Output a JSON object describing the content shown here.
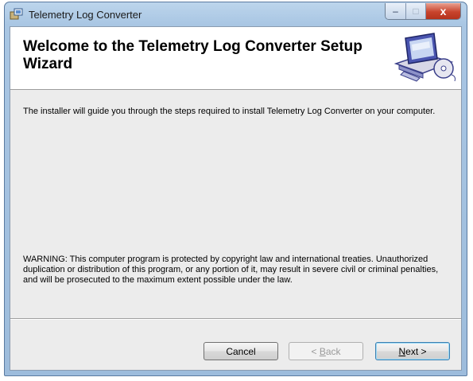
{
  "window": {
    "title": "Telemetry Log Converter",
    "controls": {
      "minimize": "–",
      "maximize": "□",
      "close": "x"
    }
  },
  "banner": {
    "heading": "Welcome to the Telemetry Log Converter Setup Wizard",
    "icon": "computer-setup-icon"
  },
  "body": {
    "intro": "The installer will guide you through the steps required to install Telemetry Log Converter on your computer.",
    "warning": "WARNING: This computer program is protected by copyright law and international treaties. Unauthorized duplication or distribution of this program, or any portion of it, may result in severe civil or criminal penalties, and will be prosecuted to the maximum extent possible under the law."
  },
  "buttons": {
    "cancel": "Cancel",
    "back": {
      "prefix": "< ",
      "mnemonic": "B",
      "rest": "ack",
      "enabled": false
    },
    "next": {
      "mnemonic": "N",
      "rest": "ext >",
      "default": true
    }
  },
  "colors": {
    "titlebar": "#a9c6e3",
    "close": "#c8442d",
    "default_button_border": "#3c7fb1"
  }
}
